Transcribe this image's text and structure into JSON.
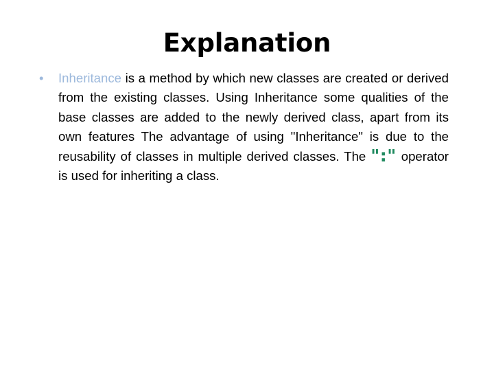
{
  "slide": {
    "title": "Explanation",
    "background_color": "#FFFFFF",
    "bullet": {
      "marker": "•",
      "marker_color": "#9DB9DC",
      "keyword": "Inheritance",
      "keyword_color": "#9DB9DC",
      "text_color": "#000000",
      "segment_1": " is a method by which new classes are created or derived from the existing classes. Using Inheritance some qualities of the base classes are added to the newly derived class, apart from its own features The advantage of using \"Inheritance\" is due to the reusability of classes in multiple derived classes. The ",
      "operator": "\":\"",
      "operator_color": "#1F8A5F",
      "segment_2": " operator is used for inheriting a class.",
      "full_text": "Inheritance is a method by which new classes are created or derived from the existing classes. Using Inheritance some qualities of the base classes are added to the newly derived class, apart from its own features The advantage of using \"Inheritance\" is due to the reusability of classes in multiple derived classes. The \":\" operator is used for inheriting a class."
    }
  }
}
